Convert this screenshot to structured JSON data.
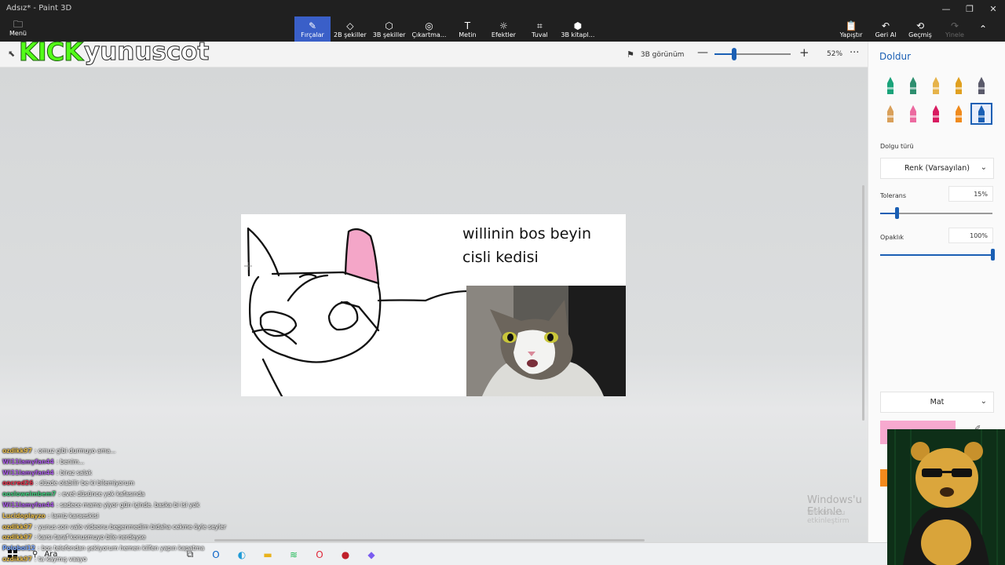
{
  "window": {
    "title": "Adsız* - Paint 3D"
  },
  "window_controls": [
    "—",
    "❐",
    "✕"
  ],
  "menu": {
    "label": "Menü"
  },
  "toolbar": {
    "tabs": [
      {
        "label": "Fırçalar",
        "icon": "brush-icon",
        "glyph": "✎"
      },
      {
        "label": "2B şekiller",
        "icon": "2d-shapes-icon",
        "glyph": "◇"
      },
      {
        "label": "3B şekiller",
        "icon": "3d-shapes-icon",
        "glyph": "⬡"
      },
      {
        "label": "Çıkartma...",
        "icon": "stickers-icon",
        "glyph": "◎"
      },
      {
        "label": "Metin",
        "icon": "text-icon",
        "glyph": "T"
      },
      {
        "label": "Efektler",
        "icon": "effects-icon",
        "glyph": "☼"
      },
      {
        "label": "Tuval",
        "icon": "canvas-icon",
        "glyph": "⌗"
      },
      {
        "label": "3B kitapl...",
        "icon": "3d-library-icon",
        "glyph": "⬢"
      }
    ],
    "active_tab": "Fırçalar",
    "paste_label": "Yapıştır",
    "undo_label": "Geri Al",
    "history_label": "Geçmiş",
    "redo_label": "Yinele"
  },
  "overlay_logo": {
    "kick": "KICK",
    "name": "yunuscot"
  },
  "subbar": {
    "view3d_label": "3B görünüm",
    "zoom_minus": "—",
    "zoom_plus": "+",
    "zoom_percent": 52,
    "zoom_value": "52%",
    "more": "···"
  },
  "canvas": {
    "text": "willinin bos beyin\ncisli kedisi"
  },
  "watermark": {
    "line1": "Windows'u Etkinle",
    "line2": "Windows'u etkinleştirm"
  },
  "chat": [
    {
      "user": "ozdikk97",
      "color": "#e3b94a",
      "text": ": omuz gibi durmuyo ama..."
    },
    {
      "user": "Wi11lamyfan44",
      "color": "#a65be0",
      "text": ": benim..."
    },
    {
      "user": "Wi11lamyfan44",
      "color": "#a65be0",
      "text": ": biraz salak"
    },
    {
      "user": "oocred26",
      "color": "#e0304a",
      "text": ": düzde olabilir be ki bilemiyorum"
    },
    {
      "user": "oosloweimbem7",
      "color": "#3fc77a",
      "text": ": evet düsünce yok kafasında"
    },
    {
      "user": "Wi11lamyfan44",
      "color": "#a65be0",
      "text": ": sadece mama yiyor gün içinde. baska bi isi yok"
    },
    {
      "user": "Lucidoplayzo",
      "color": "#e3b94a",
      "text": ": lamiz karaeskisi"
    },
    {
      "user": "ozdikk97",
      "color": "#e3b94a",
      "text": ": yunus son valo videonu begenmedim bidaha cekme öyle seyler"
    },
    {
      "user": "ozdikk97",
      "color": "#e3b94a",
      "text": ": karsı taraf konusmuyo bile nerdeyse"
    },
    {
      "user": "Poloboi12",
      "color": "#7aa7ff",
      "text": ": bos telefondan şekiyorum hemen kilfen yapın kapatma"
    },
    {
      "user": "ozdikk97",
      "color": "#e3b94a",
      "text": ": ta kaymış vaayo"
    }
  ],
  "panel": {
    "title": "Doldur",
    "brushes": [
      {
        "icon": "marker-icon",
        "color": "#1aa37a"
      },
      {
        "icon": "calligraphy-pen-icon",
        "color": "#2e8f6f"
      },
      {
        "icon": "oil-brush-icon",
        "color": "#e6b34a"
      },
      {
        "icon": "watercolor-icon",
        "color": "#e0a020"
      },
      {
        "icon": "pixel-pen-icon",
        "color": "#5a5a6a"
      },
      {
        "icon": "pencil-icon",
        "color": "#d9a05a"
      },
      {
        "icon": "eraser-icon",
        "color": "#ec6aa0"
      },
      {
        "icon": "crayon-icon",
        "color": "#d81b60"
      },
      {
        "icon": "spray-can-icon",
        "color": "#f08a1c"
      },
      {
        "icon": "fill-bucket-icon",
        "color": "#1a5fb4"
      }
    ],
    "selected_brush": 9,
    "fill_type_label": "Dolgu türü",
    "fill_type_value": "Renk (Varsayılan)",
    "tolerance_label": "Tolerans",
    "tolerance_value": "15%",
    "tolerance": 15,
    "opacity_label": "Opaklık",
    "opacity_value": "100%",
    "opacity": 100,
    "finish_value": "Mat",
    "swatch_color": "#f7a9cf"
  },
  "taskbar": {
    "search_label": "Ara",
    "icons": [
      {
        "icon": "task-view-icon",
        "glyph": "⧉",
        "color": "#333"
      },
      {
        "icon": "outlook-icon",
        "glyph": "O",
        "color": "#0a64c8"
      },
      {
        "icon": "edge-icon",
        "glyph": "◐",
        "color": "#1f9bd7"
      },
      {
        "icon": "file-explorer-icon",
        "glyph": "▬",
        "color": "#e8b21c"
      },
      {
        "icon": "spotify-icon",
        "glyph": "≋",
        "color": "#1db954"
      },
      {
        "icon": "opera-icon",
        "glyph": "O",
        "color": "#e0283a"
      },
      {
        "icon": "ladybug-app-icon",
        "glyph": "●",
        "color": "#c0202a"
      },
      {
        "icon": "paint3d-icon",
        "glyph": "◆",
        "color": "#7a5cf0"
      }
    ]
  }
}
